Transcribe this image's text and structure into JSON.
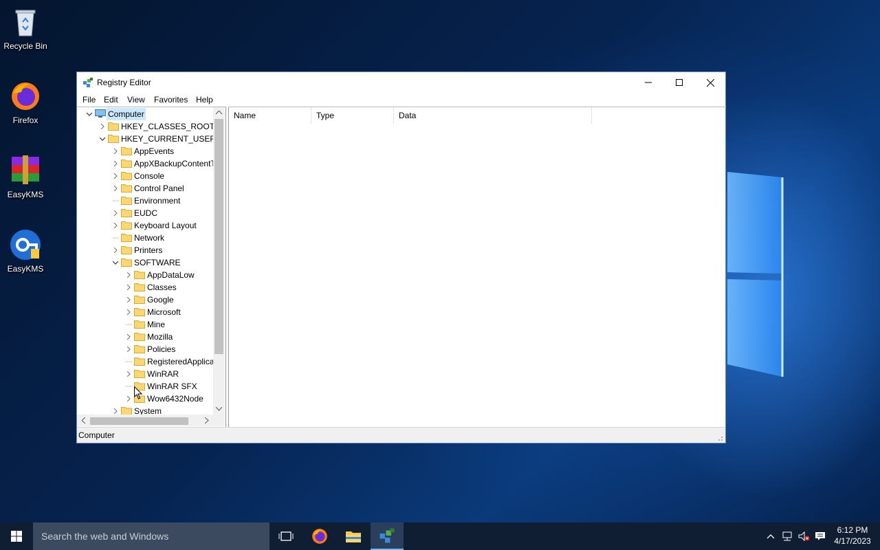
{
  "desktop": {
    "icons": [
      {
        "label": "Recycle Bin",
        "icon": "recycle-bin-icon"
      },
      {
        "label": "Firefox",
        "icon": "firefox-icon"
      },
      {
        "label": "EasyKMS",
        "icon": "winrar-icon"
      },
      {
        "label": "EasyKMS",
        "icon": "easykms-icon"
      }
    ]
  },
  "window": {
    "title": "Registry Editor",
    "menu": [
      "File",
      "Edit",
      "View",
      "Favorites",
      "Help"
    ],
    "tree": [
      {
        "label": "Computer",
        "level": 0,
        "expanded": true,
        "selected": true
      },
      {
        "label": "HKEY_CLASSES_ROOT",
        "level": 1,
        "expandable": true
      },
      {
        "label": "HKEY_CURRENT_USER",
        "level": 1,
        "expanded": true
      },
      {
        "label": "AppEvents",
        "level": 2,
        "expandable": true
      },
      {
        "label": "AppXBackupContentT",
        "level": 2,
        "expandable": true
      },
      {
        "label": "Console",
        "level": 2,
        "expandable": true
      },
      {
        "label": "Control Panel",
        "level": 2,
        "expandable": true
      },
      {
        "label": "Environment",
        "level": 2,
        "expandable": false
      },
      {
        "label": "EUDC",
        "level": 2,
        "expandable": true
      },
      {
        "label": "Keyboard Layout",
        "level": 2,
        "expandable": true
      },
      {
        "label": "Network",
        "level": 2,
        "expandable": false
      },
      {
        "label": "Printers",
        "level": 2,
        "expandable": true
      },
      {
        "label": "SOFTWARE",
        "level": 2,
        "expanded": true
      },
      {
        "label": "AppDataLow",
        "level": 3,
        "expandable": true
      },
      {
        "label": "Classes",
        "level": 3,
        "expandable": true
      },
      {
        "label": "Google",
        "level": 3,
        "expandable": true
      },
      {
        "label": "Microsoft",
        "level": 3,
        "expandable": true
      },
      {
        "label": "Mine",
        "level": 3,
        "expandable": false
      },
      {
        "label": "Mozilla",
        "level": 3,
        "expandable": true
      },
      {
        "label": "Policies",
        "level": 3,
        "expandable": true
      },
      {
        "label": "RegisteredApplica",
        "level": 3,
        "expandable": false
      },
      {
        "label": "WinRAR",
        "level": 3,
        "expandable": true
      },
      {
        "label": "WinRAR SFX",
        "level": 3,
        "expandable": false
      },
      {
        "label": "Wow6432Node",
        "level": 3,
        "expandable": true
      },
      {
        "label": "System",
        "level": 2,
        "expandable": true
      }
    ],
    "columns": [
      "Name",
      "Type",
      "Data"
    ],
    "status": "Computer"
  },
  "taskbar": {
    "search_placeholder": "Search the web and Windows",
    "time": "6:12 PM",
    "date": "4/17/2023"
  }
}
